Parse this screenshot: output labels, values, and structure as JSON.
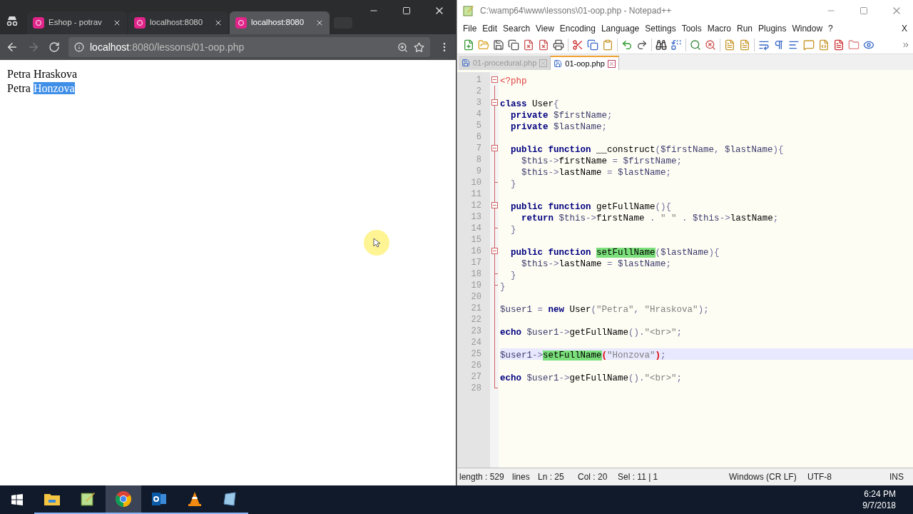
{
  "browser": {
    "tabs": [
      {
        "title": "Eshop - potrav",
        "selected": false
      },
      {
        "title": "localhost:8080",
        "selected": false
      },
      {
        "title": "localhost:8080",
        "selected": true
      }
    ],
    "address": {
      "host": "localhost",
      "path": ":8080/lessons/01-oop.php"
    },
    "page_lines": [
      [
        {
          "text": "Petra Hraskova",
          "selected": false
        }
      ],
      [
        {
          "text": "Petra ",
          "selected": false
        },
        {
          "text": "Honzova",
          "selected": true
        }
      ]
    ]
  },
  "editor": {
    "title": "C:\\wamp64\\www\\lessons\\01-oop.php - Notepad++",
    "menu": [
      "File",
      "Edit",
      "Search",
      "View",
      "Encoding",
      "Language",
      "Settings",
      "Tools",
      "Macro",
      "Run",
      "Plugins",
      "Window",
      "?"
    ],
    "menu_close": "X",
    "tabs": [
      {
        "title": "01-procedural.php",
        "selected": false
      },
      {
        "title": "01-oop.php",
        "selected": true
      }
    ],
    "lines": [
      {
        "number": "1",
        "fold_start": true,
        "fold_end": false,
        "current": false,
        "tokens": [
          {
            "kind": "php",
            "text": "<?php"
          }
        ]
      },
      {
        "number": "2",
        "fold_start": false,
        "fold_end": false,
        "current": false
      },
      {
        "number": "3",
        "fold_start": true,
        "fold_end": false,
        "current": false,
        "tokens": [
          {
            "kind": "kw",
            "text": "class"
          },
          {
            "kind": "text",
            "text": " User"
          },
          {
            "kind": "op",
            "text": "{"
          }
        ]
      },
      {
        "number": "4",
        "fold_start": false,
        "fold_end": false,
        "current": false,
        "tokens": [
          {
            "kind": "kw",
            "text": "  private"
          },
          {
            "kind": "var",
            "text": " $firstName"
          },
          {
            "kind": "op",
            "text": ";"
          }
        ]
      },
      {
        "number": "5",
        "fold_start": false,
        "fold_end": false,
        "current": false,
        "tokens": [
          {
            "kind": "kw",
            "text": "  private"
          },
          {
            "kind": "var",
            "text": " $lastName"
          },
          {
            "kind": "op",
            "text": ";"
          }
        ]
      },
      {
        "number": "6",
        "fold_start": false,
        "fold_end": false,
        "current": false
      },
      {
        "number": "7",
        "fold_start": true,
        "fold_end": false,
        "current": false,
        "tokens": [
          {
            "kind": "kw",
            "text": "  public function"
          },
          {
            "kind": "text",
            "text": " __construct"
          },
          {
            "kind": "op",
            "text": "("
          },
          {
            "kind": "var",
            "text": "$firstName"
          },
          {
            "kind": "op",
            "text": ", "
          },
          {
            "kind": "var",
            "text": "$lastName"
          },
          {
            "kind": "op",
            "text": "){"
          }
        ]
      },
      {
        "number": "8",
        "fold_start": false,
        "fold_end": false,
        "current": false,
        "tokens": [
          {
            "kind": "var",
            "text": "    $this"
          },
          {
            "kind": "op",
            "text": "->"
          },
          {
            "kind": "text",
            "text": "firstName"
          },
          {
            "kind": "op",
            "text": " = "
          },
          {
            "kind": "var",
            "text": "$firstName"
          },
          {
            "kind": "op",
            "text": ";"
          }
        ]
      },
      {
        "number": "9",
        "fold_start": false,
        "fold_end": false,
        "current": false,
        "tokens": [
          {
            "kind": "var",
            "text": "    $this"
          },
          {
            "kind": "op",
            "text": "->"
          },
          {
            "kind": "text",
            "text": "lastName"
          },
          {
            "kind": "op",
            "text": " = "
          },
          {
            "kind": "var",
            "text": "$lastName"
          },
          {
            "kind": "op",
            "text": ";"
          }
        ]
      },
      {
        "number": "10",
        "fold_start": false,
        "fold_end": true,
        "current": false,
        "tokens": [
          {
            "kind": "op",
            "text": "  }"
          }
        ]
      },
      {
        "number": "11",
        "fold_start": false,
        "fold_end": false,
        "current": false
      },
      {
        "number": "12",
        "fold_start": true,
        "fold_end": false,
        "current": false,
        "tokens": [
          {
            "kind": "kw",
            "text": "  public function"
          },
          {
            "kind": "text",
            "text": " getFullName"
          },
          {
            "kind": "op",
            "text": "(){"
          }
        ]
      },
      {
        "number": "13",
        "fold_start": false,
        "fold_end": false,
        "current": false,
        "tokens": [
          {
            "kind": "kw",
            "text": "    return"
          },
          {
            "kind": "var",
            "text": " $this"
          },
          {
            "kind": "op",
            "text": "->"
          },
          {
            "kind": "text",
            "text": "firstName"
          },
          {
            "kind": "op",
            "text": " . "
          },
          {
            "kind": "str",
            "text": "\" \""
          },
          {
            "kind": "op",
            "text": " . "
          },
          {
            "kind": "var",
            "text": "$this"
          },
          {
            "kind": "op",
            "text": "->"
          },
          {
            "kind": "text",
            "text": "lastName"
          },
          {
            "kind": "op",
            "text": ";"
          }
        ]
      },
      {
        "number": "14",
        "fold_start": false,
        "fold_end": true,
        "current": false,
        "tokens": [
          {
            "kind": "op",
            "text": "  }"
          }
        ]
      },
      {
        "number": "15",
        "fold_start": false,
        "fold_end": false,
        "current": false
      },
      {
        "number": "16",
        "fold_start": true,
        "fold_end": false,
        "current": false,
        "tokens": [
          {
            "kind": "kw",
            "text": "  public function "
          },
          {
            "kind": "mark",
            "text": "setFullName"
          },
          {
            "kind": "op",
            "text": "("
          },
          {
            "kind": "var",
            "text": "$lastName"
          },
          {
            "kind": "op",
            "text": "){"
          }
        ]
      },
      {
        "number": "17",
        "fold_start": false,
        "fold_end": false,
        "current": false,
        "tokens": [
          {
            "kind": "var",
            "text": "    $this"
          },
          {
            "kind": "op",
            "text": "->"
          },
          {
            "kind": "text",
            "text": "lastName"
          },
          {
            "kind": "op",
            "text": " = "
          },
          {
            "kind": "var",
            "text": "$lastName"
          },
          {
            "kind": "op",
            "text": ";"
          }
        ]
      },
      {
        "number": "18",
        "fold_start": false,
        "fold_end": true,
        "current": false,
        "tokens": [
          {
            "kind": "op",
            "text": "  }"
          }
        ]
      },
      {
        "number": "19",
        "fold_start": false,
        "fold_end": true,
        "current": false,
        "tokens": [
          {
            "kind": "op",
            "text": "}"
          }
        ]
      },
      {
        "number": "20",
        "fold_start": false,
        "fold_end": false,
        "current": false
      },
      {
        "number": "21",
        "fold_start": false,
        "fold_end": false,
        "current": false,
        "tokens": [
          {
            "kind": "var",
            "text": "$user1"
          },
          {
            "kind": "op",
            "text": " = "
          },
          {
            "kind": "kw",
            "text": "new"
          },
          {
            "kind": "text",
            "text": " User"
          },
          {
            "kind": "op",
            "text": "("
          },
          {
            "kind": "str",
            "text": "\"Petra\""
          },
          {
            "kind": "op",
            "text": ", "
          },
          {
            "kind": "str",
            "text": "\"Hraskova\""
          },
          {
            "kind": "op",
            "text": ");"
          }
        ]
      },
      {
        "number": "22",
        "fold_start": false,
        "fold_end": false,
        "current": false
      },
      {
        "number": "23",
        "fold_start": false,
        "fold_end": false,
        "current": false,
        "tokens": [
          {
            "kind": "kw",
            "text": "echo"
          },
          {
            "kind": "var",
            "text": " $user1"
          },
          {
            "kind": "op",
            "text": "->"
          },
          {
            "kind": "text",
            "text": "getFullName"
          },
          {
            "kind": "op",
            "text": "()."
          },
          {
            "kind": "str",
            "text": "\"<br>\""
          },
          {
            "kind": "op",
            "text": ";"
          }
        ]
      },
      {
        "number": "24",
        "fold_start": false,
        "fold_end": false,
        "current": false
      },
      {
        "number": "25",
        "fold_start": false,
        "fold_end": false,
        "current": true,
        "tokens": [
          {
            "kind": "var",
            "text": "$user1"
          },
          {
            "kind": "op",
            "text": "->"
          },
          {
            "kind": "mark",
            "text": "setFullName"
          },
          {
            "kind": "brace",
            "text": "("
          },
          {
            "kind": "str",
            "text": "\"Honzova\""
          },
          {
            "kind": "brace",
            "text": ")"
          },
          {
            "kind": "op",
            "text": ";"
          }
        ]
      },
      {
        "number": "26",
        "fold_start": false,
        "fold_end": false,
        "current": false
      },
      {
        "number": "27",
        "fold_start": false,
        "fold_end": false,
        "current": false,
        "tokens": [
          {
            "kind": "kw",
            "text": "echo"
          },
          {
            "kind": "var",
            "text": " $user1"
          },
          {
            "kind": "op",
            "text": "->"
          },
          {
            "kind": "text",
            "text": "getFullName"
          },
          {
            "kind": "op",
            "text": "()."
          },
          {
            "kind": "str",
            "text": "\"<br>\""
          },
          {
            "kind": "op",
            "text": ";"
          }
        ]
      },
      {
        "number": "28",
        "fold_start": false,
        "fold_end": true,
        "current": false
      }
    ],
    "status": [
      "length : 529",
      "lines",
      "Ln : 25",
      "Col : 20",
      "Sel : 11 | 1",
      "Windows (CR LF)",
      "UTF-8",
      "INS"
    ]
  },
  "taskbar": {
    "apps": [
      {
        "kind": "explorer",
        "selected": false
      },
      {
        "kind": "notepad",
        "selected": false
      },
      {
        "kind": "chrome",
        "selected": true
      },
      {
        "kind": "outlook",
        "selected": false
      },
      {
        "kind": "vlc",
        "selected": false
      },
      {
        "kind": "other",
        "selected": false
      }
    ],
    "time": "6:24 PM",
    "date": "9/7/2018"
  }
}
